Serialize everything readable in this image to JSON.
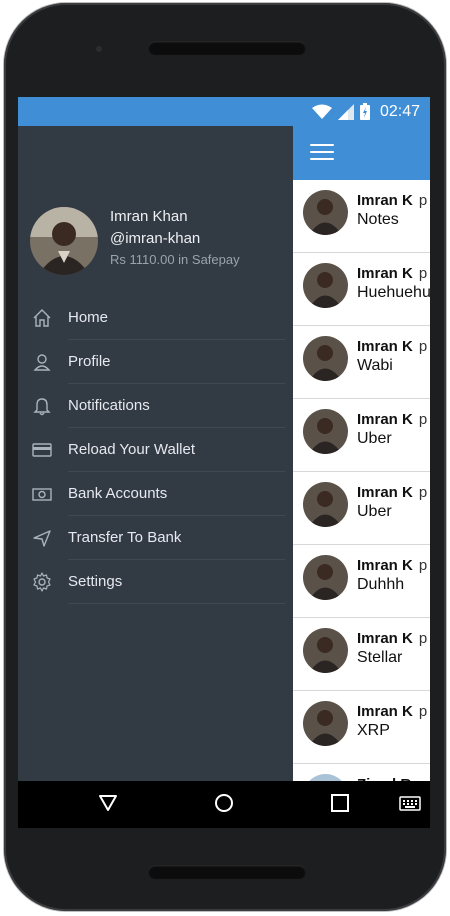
{
  "status_bar": {
    "time": "02:47",
    "color": "#3f8ed6"
  },
  "drawer": {
    "user": {
      "name": "Imran Khan",
      "handle": "@imran-khan",
      "balance": "Rs 1110.00 in Safepay"
    },
    "items": [
      {
        "label": "Home",
        "icon": "home-icon"
      },
      {
        "label": "Profile",
        "icon": "person-icon"
      },
      {
        "label": "Notifications",
        "icon": "bell-icon"
      },
      {
        "label": "Reload Your Wallet",
        "icon": "credit-card-icon"
      },
      {
        "label": "Bank Accounts",
        "icon": "bank-note-icon"
      },
      {
        "label": "Transfer To Bank",
        "icon": "send-icon"
      },
      {
        "label": "Settings",
        "icon": "gear-icon"
      }
    ]
  },
  "feed": {
    "items": [
      {
        "name": "Imran K",
        "suffix": "p",
        "note": "Notes"
      },
      {
        "name": "Imran K",
        "suffix": "p",
        "note": "Huehuehu"
      },
      {
        "name": "Imran K",
        "suffix": "p",
        "note": "Wabi"
      },
      {
        "name": "Imran K",
        "suffix": "p",
        "note": "Uber"
      },
      {
        "name": "Imran K",
        "suffix": "p",
        "note": "Uber"
      },
      {
        "name": "Imran K",
        "suffix": "p",
        "note": "Duhhh"
      },
      {
        "name": "Imran K",
        "suffix": "p",
        "note": "Stellar"
      },
      {
        "name": "Imran K",
        "suffix": "p",
        "note": "XRP"
      },
      {
        "name": "Ziyad R",
        "suffix": "p",
        "note": ""
      }
    ]
  },
  "colors": {
    "accent": "#3f8ed6",
    "drawer": "#323a44"
  }
}
